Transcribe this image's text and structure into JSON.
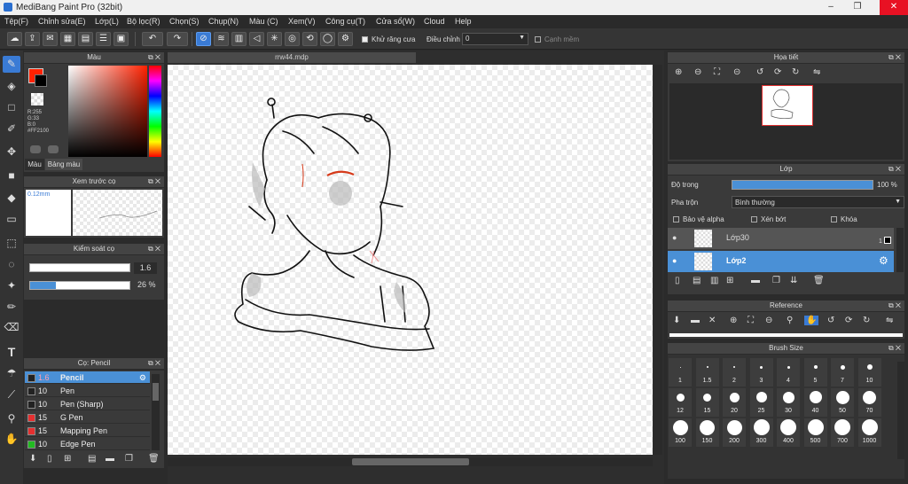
{
  "app": {
    "title": "MediBang Paint Pro (32bit)"
  },
  "menu": [
    "Tệp(F)",
    "Chỉnh sửa(E)",
    "Lớp(L)",
    "Bộ lọc(R)",
    "Chọn(S)",
    "Chụp(N)",
    "Màu (C)",
    "Xem(V)",
    "Công cụ(T)",
    "Cửa sổ(W)",
    "Cloud",
    "Help"
  ],
  "toolbar": {
    "antialias_label": "Khử răng cưa",
    "adjust_label": "Điều chỉnh",
    "adjust_value": "0",
    "edge_label": "Cạnh mềm"
  },
  "color_panel": {
    "title": "Màu",
    "r": "R:255",
    "g": "G:33",
    "b": "B:0",
    "hex": "#FF2100",
    "tab_color": "Màu",
    "tab_palette": "Bảng màu",
    "primary": "#ff2100"
  },
  "brush_preview": {
    "title": "Xem trước cọ",
    "size": "0.12mm"
  },
  "brush_control": {
    "title": "Kiểm soát cọ",
    "size_value": "1.6",
    "opacity_value": "26 %",
    "opacity": 0.26
  },
  "brush_list": {
    "title": "Cọ: Pencil",
    "items": [
      {
        "size": "1.6",
        "name": "Pencil",
        "color": "#222222"
      },
      {
        "size": "10",
        "name": "Pen",
        "color": "#222222"
      },
      {
        "size": "10",
        "name": "Pen (Sharp)",
        "color": "#222222"
      },
      {
        "size": "15",
        "name": "G Pen",
        "color": "#e53030"
      },
      {
        "size": "15",
        "name": "Mapping Pen",
        "color": "#e53030"
      },
      {
        "size": "10",
        "name": "Edge Pen",
        "color": "#22bb22"
      }
    ]
  },
  "canvas": {
    "tab": "rrw44.mdp"
  },
  "navigator": {
    "title": "Họa tiết"
  },
  "layers": {
    "title": "Lớp",
    "opacity_label": "Độ trong",
    "opacity_value": "100 %",
    "opacity": 1.0,
    "blend_label": "Pha trộn",
    "blend_value": "Bình thường",
    "protect_alpha": "Bảo vệ alpha",
    "clipping": "Xén bớt",
    "lock": "Khóa",
    "items": [
      {
        "name": "Lớp30",
        "selected": false
      },
      {
        "name": "Lớp2",
        "selected": true
      }
    ],
    "badge": "1"
  },
  "reference": {
    "title": "Reference"
  },
  "brush_size": {
    "title": "Brush Size",
    "sizes": [
      "1",
      "1.5",
      "2",
      "3",
      "4",
      "5",
      "7",
      "10",
      "12",
      "15",
      "20",
      "25",
      "30",
      "40",
      "50",
      "70",
      "100",
      "150",
      "200",
      "300",
      "400",
      "500",
      "700",
      "1000"
    ]
  }
}
